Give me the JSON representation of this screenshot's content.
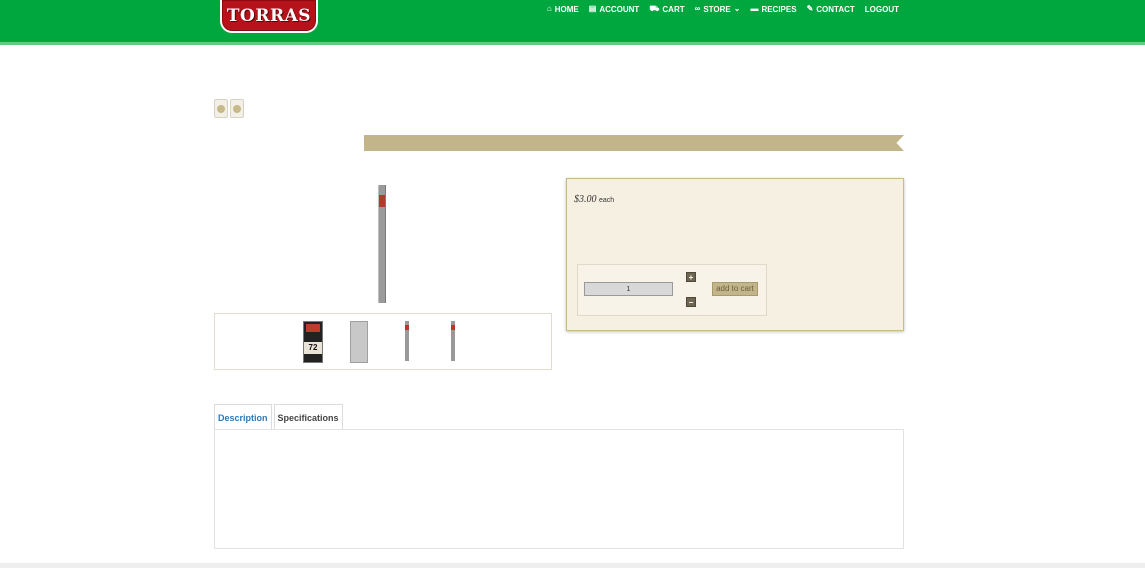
{
  "brand": {
    "name": "TORRAS"
  },
  "nav": {
    "items": [
      {
        "id": "home",
        "label": "HOME",
        "icon": "home-icon"
      },
      {
        "id": "account",
        "label": "ACCOUNT",
        "icon": "id-card-icon"
      },
      {
        "id": "cart",
        "label": "CART",
        "icon": "cart-icon"
      },
      {
        "id": "store",
        "label": "STORE",
        "icon": "binoculars-icon"
      },
      {
        "id": "recipes",
        "label": "RECIPES",
        "icon": "book-icon"
      },
      {
        "id": "contact",
        "label": "CONTACT",
        "icon": "edit-icon"
      },
      {
        "id": "logout",
        "label": "LOGOUT",
        "icon": ""
      }
    ]
  },
  "product": {
    "price": "$3.00",
    "unit": "each",
    "quantity": "1",
    "add_to_cart_label": "add to cart",
    "thumbnail_label": "72"
  },
  "tabs": [
    {
      "label": "Description",
      "active": true
    },
    {
      "label": "Specifications",
      "active": false
    }
  ],
  "colors": {
    "header_green": "#00a63e",
    "brand_red": "#b5121b",
    "ribbon_tan": "#c2b58a",
    "panel_cream": "#f5f0e2",
    "tab_active_blue": "#2d7ab8"
  }
}
